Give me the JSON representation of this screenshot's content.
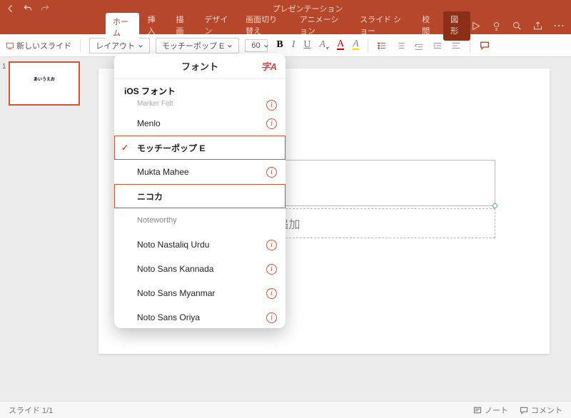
{
  "app": {
    "title": "プレゼンテーション"
  },
  "tabs": {
    "home": "ホーム",
    "insert": "挿入",
    "draw": "描画",
    "design": "デザイン",
    "transition": "画面切り替え",
    "animation": "アニメーション",
    "slideshow": "スライド ショー",
    "review": "校閲",
    "shape": "図形"
  },
  "toolbar": {
    "new_slide": "新しいスライド",
    "layout": "レイアウト",
    "font_name": "モッチーポップ E",
    "font_size": "60",
    "bold": "B",
    "italic": "I",
    "underline": "U",
    "font_effects": "A",
    "font_color": "A",
    "highlight": "A"
  },
  "thumb": {
    "num": "1",
    "title": "あいうえお"
  },
  "slide": {
    "title": "いうえお",
    "subtitle_placeholder": "プしてサブタイトルを追加"
  },
  "popover": {
    "title": "フォント",
    "ja_icon": "字A",
    "section": "iOS フォント",
    "items": [
      {
        "name": "Marker Felt",
        "partial": true,
        "info": true
      },
      {
        "name": "Menlo",
        "info": true
      },
      {
        "name": "モッチーポップ E",
        "checked": true,
        "bold": true,
        "hl": true
      },
      {
        "name": "Mukta Mahee",
        "info": true
      },
      {
        "name": "ニコカ",
        "bold": true,
        "hl": true
      },
      {
        "name": "Noteworthy",
        "serif": true
      },
      {
        "name": "Noto Nastaliq Urdu",
        "info": true
      },
      {
        "name": "Noto Sans Kannada",
        "info": true
      },
      {
        "name": "Noto Sans Myanmar",
        "info": true
      },
      {
        "name": "Noto Sans Oriya",
        "info": true
      }
    ]
  },
  "status": {
    "slide_counter": "スライド 1/1",
    "notes": "ノート",
    "comments": "コメント"
  }
}
